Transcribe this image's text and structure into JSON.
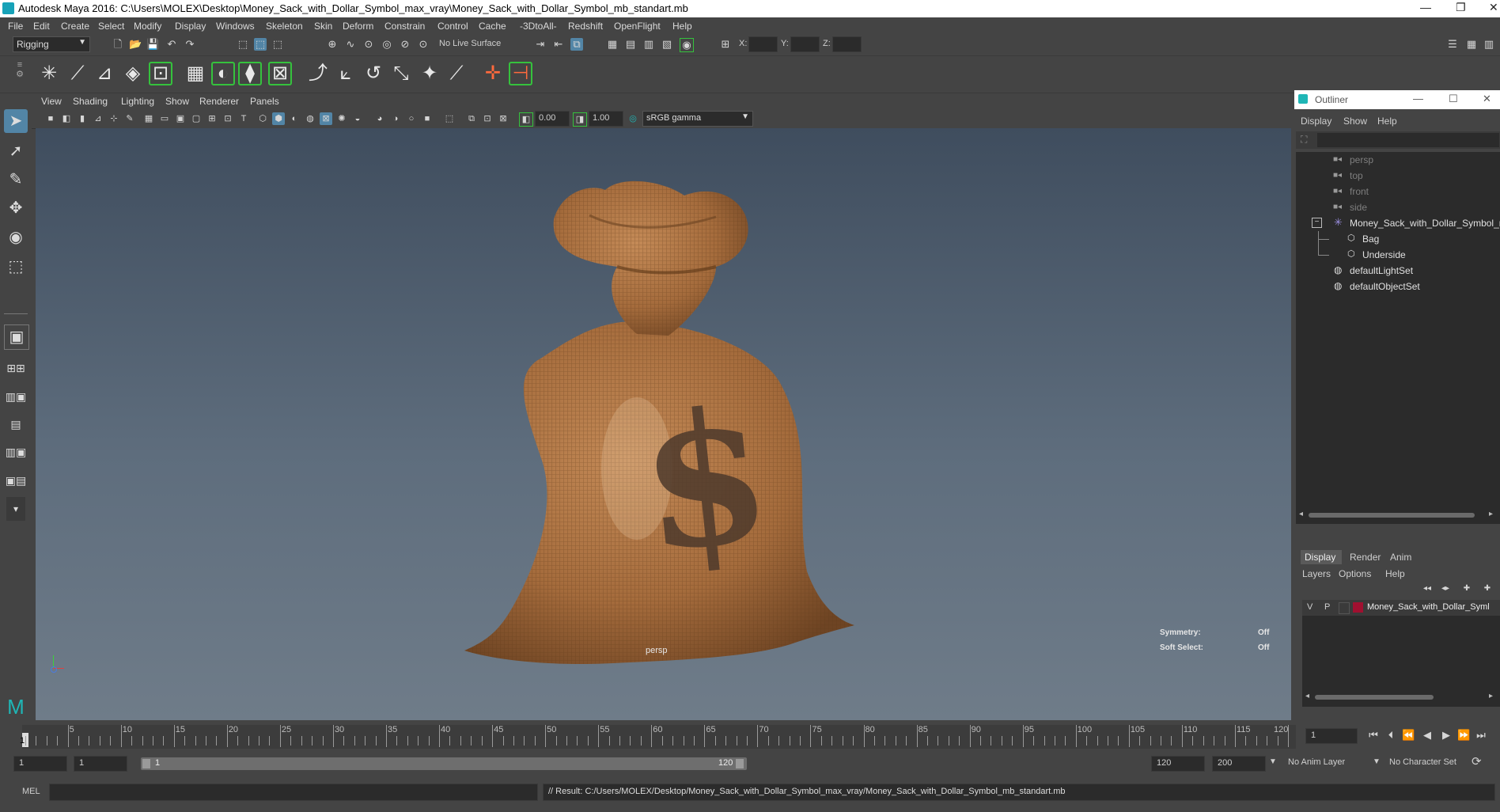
{
  "window": {
    "title": "Autodesk Maya 2016: C:\\Users\\MOLEX\\Desktop\\Money_Sack_with_Dollar_Symbol_max_vray\\Money_Sack_with_Dollar_Symbol_mb_standart.mb",
    "minimize": "—",
    "restore": "❐",
    "close": "✕"
  },
  "menu": [
    "File",
    "Edit",
    "Create",
    "Select",
    "Modify",
    "Display",
    "Windows",
    "Skeleton",
    "Skin",
    "Deform",
    "Constrain",
    "Control",
    "Cache",
    "-3DtoAll-",
    "Redshift",
    "OpenFlight",
    "Help"
  ],
  "status": {
    "mode": "Rigging",
    "live_surface": "No Live Surface",
    "x_label": "X:",
    "y_label": "Y:",
    "z_label": "Z:"
  },
  "panel_menu": [
    "View",
    "Shading",
    "Lighting",
    "Show",
    "Renderer",
    "Panels"
  ],
  "panel_bar": {
    "exposure": "0.00",
    "gamma": "1.00",
    "color_space": "sRGB gamma"
  },
  "viewport": {
    "camera_label": "persp",
    "symmetry_label": "Symmetry:",
    "symmetry_value": "Off",
    "soft_select_label": "Soft Select:",
    "soft_select_value": "Off"
  },
  "outliner": {
    "title": "Outliner",
    "menu": [
      "Display",
      "Show",
      "Help"
    ],
    "items": [
      {
        "label": "persp",
        "dim": true
      },
      {
        "label": "top",
        "dim": true
      },
      {
        "label": "front",
        "dim": true
      },
      {
        "label": "side",
        "dim": true
      },
      {
        "label": "Money_Sack_with_Dollar_Symbol_ncl",
        "dim": false
      },
      {
        "label": "Bag",
        "dim": false
      },
      {
        "label": "Underside",
        "dim": false
      },
      {
        "label": "defaultLightSet",
        "dim": false
      },
      {
        "label": "defaultObjectSet",
        "dim": false
      }
    ]
  },
  "layers": {
    "tabs": [
      "Display",
      "Render",
      "Anim"
    ],
    "menu": [
      "Layers",
      "Options",
      "Help"
    ],
    "row": {
      "v": "V",
      "p": "P",
      "name": "Money_Sack_with_Dollar_Syml",
      "color": "#a01030"
    }
  },
  "timeline": {
    "ticks": [
      5,
      10,
      15,
      20,
      25,
      30,
      35,
      40,
      45,
      50,
      55,
      60,
      65,
      70,
      75,
      80,
      85,
      90,
      95,
      100,
      105,
      110,
      115,
      120
    ],
    "start_marker": "1",
    "current_frame": "1",
    "range_start": "1",
    "range_start2": "1",
    "slider_start": "1",
    "slider_end": "120",
    "end1": "120",
    "end2": "200",
    "anim_layer": "No Anim Layer",
    "char_set": "No Character Set"
  },
  "command": {
    "mel_label": "MEL",
    "result": "// Result: C:/Users/MOLEX/Desktop/Money_Sack_with_Dollar_Symbol_max_vray/Money_Sack_with_Dollar_Symbol_mb_standart.mb"
  }
}
